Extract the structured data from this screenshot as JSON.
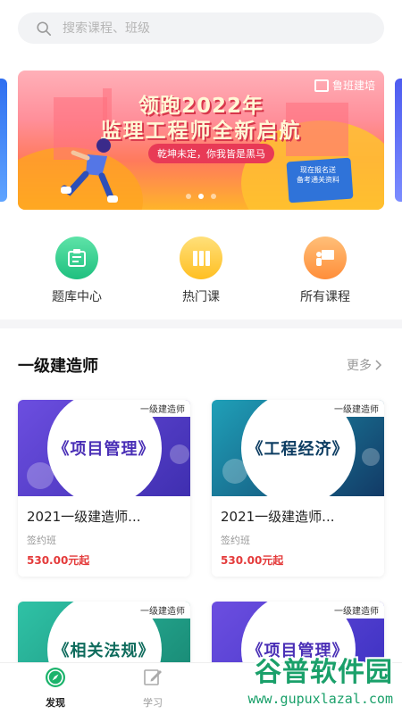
{
  "search": {
    "placeholder": "搜索课程、班级"
  },
  "banner": {
    "brand": "鲁班建培",
    "line1": "领跑2022年",
    "line2": "监理工程师全新启航",
    "pill": "乾坤未定，你我皆是黑马",
    "book_text": "现在报名送\n备考通关资料",
    "slides": 3,
    "active_slide": 2
  },
  "quick_links": [
    {
      "label": "题库中心",
      "icon": "question-bank-icon",
      "color": "#2fcf8f"
    },
    {
      "label": "热门课",
      "icon": "books-icon",
      "color": "#ffc531"
    },
    {
      "label": "所有课程",
      "icon": "teacher-board-icon",
      "color": "#ff9f45"
    }
  ],
  "section": {
    "title": "一级建造师",
    "more": "更多"
  },
  "courses": [
    {
      "tag": "一级建造师",
      "name": "《项目管理》",
      "title": "2021一级建造师...",
      "type": "签约班",
      "price": "530.00元起",
      "bg": "#5b46c8",
      "name_color": "#4a2fb6"
    },
    {
      "tag": "一级建造师",
      "name": "《工程经济》",
      "title": "2021一级建造师...",
      "type": "签约班",
      "price": "530.00元起",
      "bg": "#1a5a7a",
      "name_color": "#0d3d62"
    },
    {
      "tag": "一级建造师",
      "name": "《相关法规》",
      "bg": "#1f9e86",
      "name_color": "#0e6b5c"
    },
    {
      "tag": "一级建造师",
      "name": "《项目管理》",
      "bg": "#4f3fcf",
      "name_color": "#4a2fb6"
    }
  ],
  "tabbar": [
    {
      "label": "发现",
      "icon": "compass-icon",
      "active": true
    },
    {
      "label": "学习",
      "icon": "edit-icon",
      "active": false
    }
  ],
  "watermark": {
    "line1": "谷普软件园",
    "line2": "www.gupuxlazal.com"
  }
}
